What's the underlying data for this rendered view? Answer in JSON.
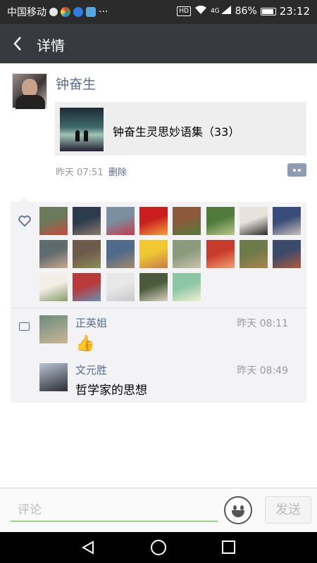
{
  "status_bar": {
    "carrier": "中国移动",
    "dots": "···",
    "hd": "HD",
    "network": "4G",
    "battery": "86%",
    "time": "23:12"
  },
  "header": {
    "title": "详情",
    "back_icon": "back-arrow-icon"
  },
  "post": {
    "author": "钟奋生",
    "share_title": "钟奋生灵思妙语集（33）",
    "time": "昨天 07:51",
    "delete_label": "删除"
  },
  "likes": {
    "icon": "heart-icon",
    "avatar_colors": [
      [
        "#6b7a5a",
        "#c84a3a"
      ],
      [
        "#2c3b4d",
        "#8b7a6a"
      ],
      [
        "#7a8fa0",
        "#c8394a"
      ],
      [
        "#c81e1e",
        "#f2a13a"
      ],
      [
        "#8a5a3a",
        "#4e7d3a"
      ],
      [
        "#4f7a3a",
        "#b9c98a"
      ],
      [
        "#e8e2dc",
        "#2b2b2b"
      ],
      [
        "#3a4c7a",
        "#c9c0b7"
      ],
      [
        "#5e6b6f",
        "#caa88f"
      ],
      [
        "#6e5a4a",
        "#8c8f5a"
      ],
      [
        "#4f6a8a",
        "#a48a6a"
      ],
      [
        "#f0c832",
        "#c77a4a"
      ],
      [
        "#8a9a7a",
        "#c9c2b0"
      ],
      [
        "#c83a2a",
        "#f0a070"
      ],
      [
        "#6f7a4a",
        "#a9854a"
      ],
      [
        "#3a4a6a",
        "#b05a3a"
      ],
      [
        "#f4efe6",
        "#8a9a6a"
      ],
      [
        "#b83a3a",
        "#6a8fb0"
      ],
      [
        "#e7e7e7",
        "#c8c8c8"
      ],
      [
        "#4a5a3a",
        "#d9d4c2"
      ],
      [
        "#8cc6a4",
        "#eef0d2"
      ]
    ]
  },
  "comments": [
    {
      "name": "正英姐",
      "time": "昨天 08:11",
      "text": "👍",
      "avatar_colors": [
        "#6e8a7a",
        "#c8b79a"
      ]
    },
    {
      "name": "文元胜",
      "time": "昨天 08:49",
      "text": "哲学家的思想",
      "avatar_colors": [
        "#b9c6d4",
        "#2b2b35"
      ]
    }
  ],
  "input": {
    "placeholder": "评论",
    "send_label": "发送",
    "emoji_icon": "smiley-icon"
  }
}
